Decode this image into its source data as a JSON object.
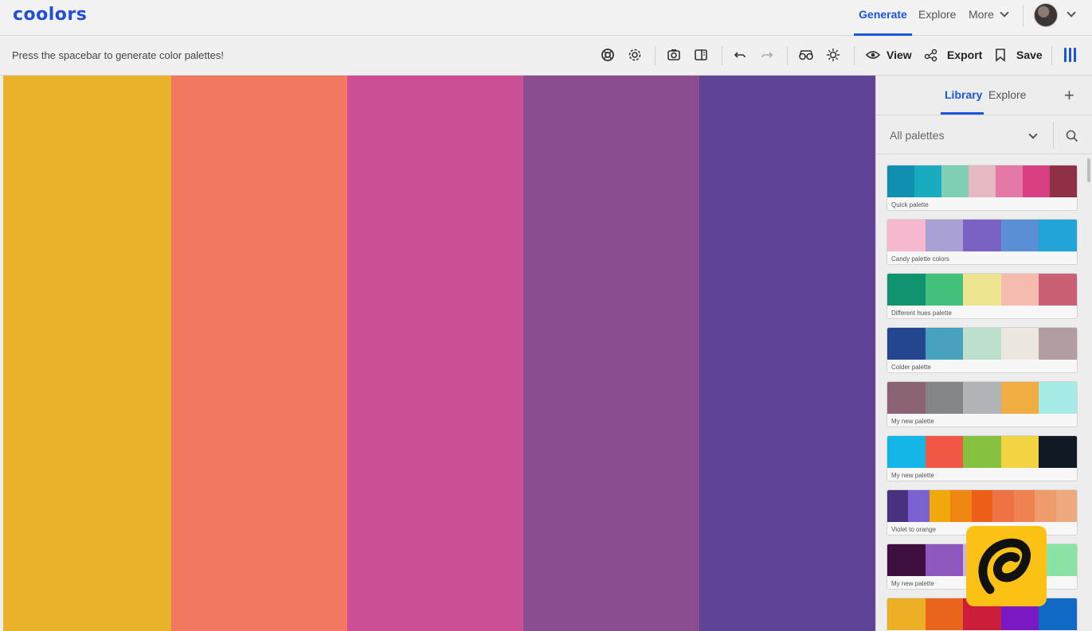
{
  "app": {
    "logo": "coolors"
  },
  "nav": {
    "generate": "Generate",
    "explore": "Explore",
    "more": "More"
  },
  "toolbar": {
    "hint": "Press the spacebar to generate color palettes!",
    "view": "View",
    "export": "Export",
    "save": "Save"
  },
  "palette": {
    "colors": [
      "#e8b22a",
      "#f27861",
      "#cc4f95",
      "#8a4e90",
      "#5f4397"
    ]
  },
  "panel": {
    "tab_library": "Library",
    "tab_explore": "Explore",
    "filter_value": "All palettes",
    "palettes": [
      {
        "name": "Quick palette",
        "colors": [
          "#118fb0",
          "#19acc0",
          "#7fcfb5",
          "#e6b9c2",
          "#e479a8",
          "#d84082",
          "#8f3045"
        ]
      },
      {
        "name": "Candy palette colors",
        "colors": [
          "#f6b8cf",
          "#a9a0d3",
          "#7a62c4",
          "#5a8fd6",
          "#22a4d9"
        ]
      },
      {
        "name": "Different hues palette",
        "colors": [
          "#11936f",
          "#42c07c",
          "#ece48f",
          "#f5bbae",
          "#c96074"
        ]
      },
      {
        "name": "Colder palette",
        "colors": [
          "#23468f",
          "#4aa0bf",
          "#bde0ce",
          "#ece6e0",
          "#b29da2"
        ]
      },
      {
        "name": "My new palette",
        "colors": [
          "#8a6474",
          "#838688",
          "#b1b4b7",
          "#f0ad41",
          "#a6ebe5"
        ]
      },
      {
        "name": "My new palette",
        "colors": [
          "#14b6e8",
          "#f25645",
          "#86c140",
          "#f2d442",
          "#0f1a25"
        ]
      },
      {
        "name": "Violet to orange",
        "colors": [
          "#48327f",
          "#7a62d2",
          "#f1a80c",
          "#f08711",
          "#ee5f1a",
          "#ee7243",
          "#ee8252",
          "#ee9c6b",
          "#eeaa7f"
        ]
      },
      {
        "name": "My new palette",
        "colors": [
          "#3e0f3e",
          "#8d57bd",
          "#c9b4e6",
          "#a5ddc2",
          "#8ae3a4"
        ]
      },
      {
        "name": "",
        "colors": [
          "#ecaf25",
          "#e9641c",
          "#cc1e3a",
          "#7b19c4",
          "#1069c4"
        ]
      }
    ]
  }
}
